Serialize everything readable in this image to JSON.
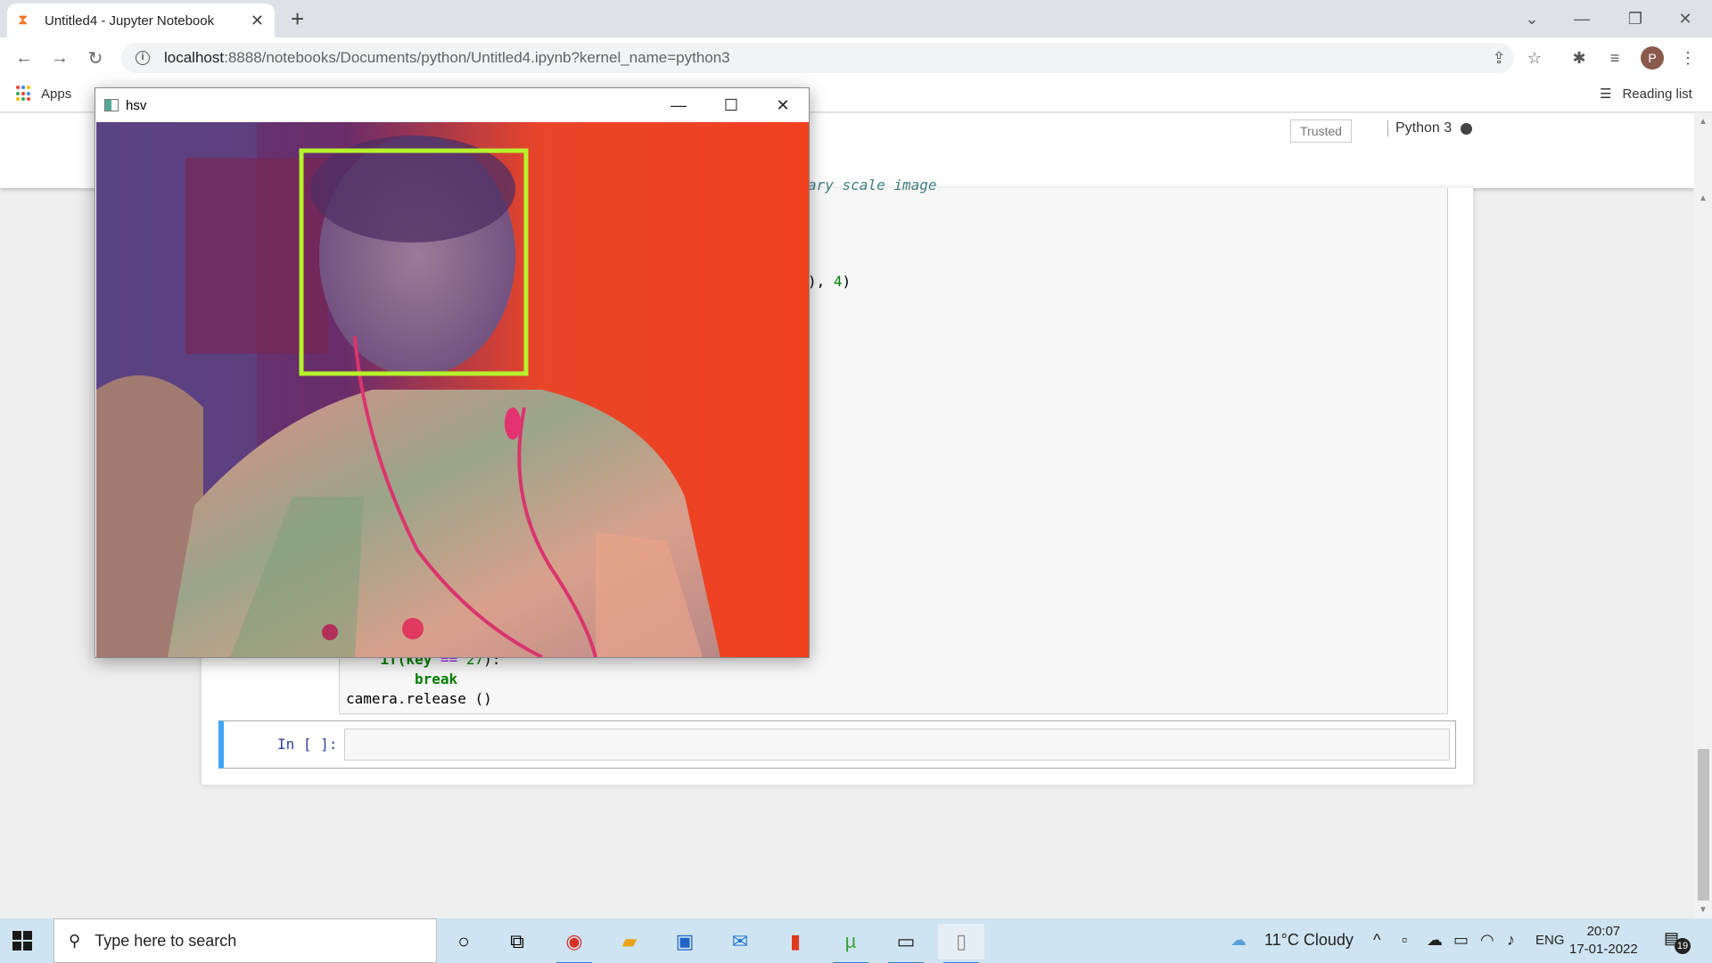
{
  "browser": {
    "tab_title": "Untitled4 - Jupyter Notebook",
    "url_host": "localhost",
    "url_path": ":8888/notebooks/Documents/python/Untitled4.ipynb?kernel_name=python3",
    "bookmarks": {
      "apps_label": "Apps",
      "reading_list_label": "Reading list"
    },
    "profile_initial": "P"
  },
  "jupyter": {
    "trusted_label": "Trusted",
    "kernel_label": "Python 3",
    "code_fragments": {
      "comment_tail": "ary scale image",
      "rect_tail_a": "), ",
      "rect_tail_num": "4",
      "rect_tail_b": ")",
      "line_if_a": "    if(key ",
      "line_if_op": "==",
      "line_if_num": " 27",
      "line_if_b": "):",
      "line_break": "break",
      "line_release": "camera.release ()"
    },
    "empty_cell_prompt": "In [ ]:"
  },
  "opencv_window": {
    "title": "hsv"
  },
  "taskbar": {
    "search_placeholder": "Type here to search",
    "weather": "11°C  Cloudy",
    "language": "ENG",
    "time": "20:07",
    "date": "17-01-2022",
    "notification_count": "19"
  },
  "colors": {
    "accent_blue": "#42a5f5",
    "face_box": "#b6f22c",
    "jupyter_orange": "#f37726"
  }
}
